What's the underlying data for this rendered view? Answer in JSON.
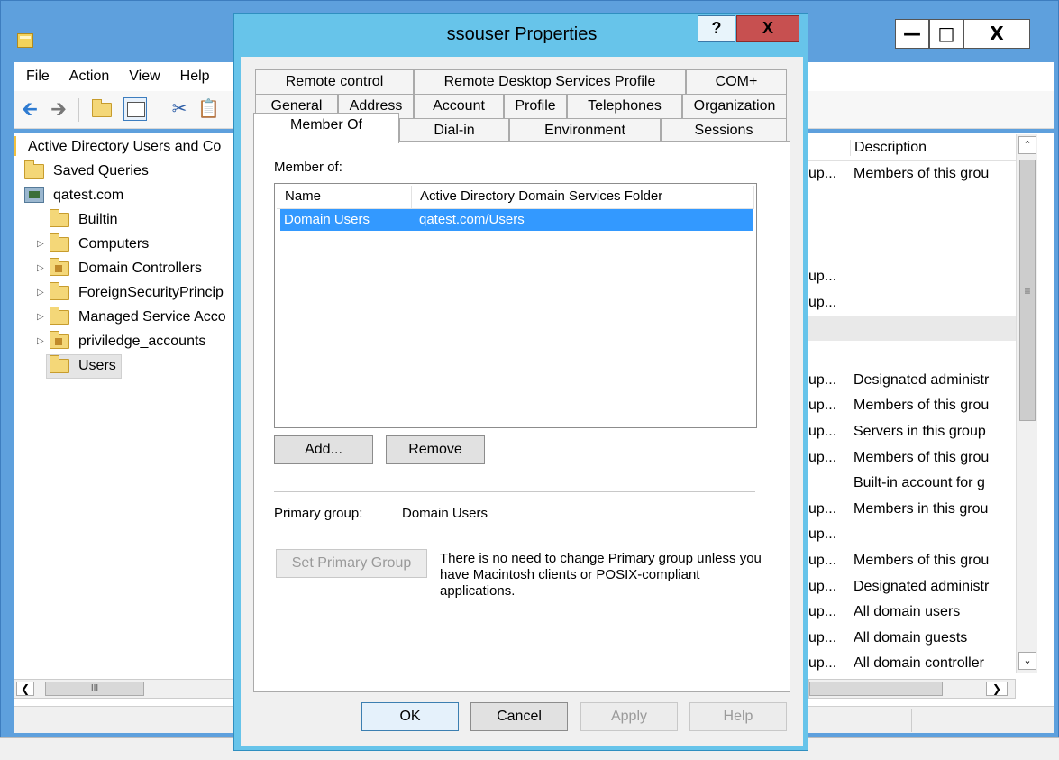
{
  "mmc": {
    "menu": [
      "File",
      "Action",
      "View",
      "Help"
    ],
    "tree": {
      "root": "Active Directory Users and Co",
      "items": [
        {
          "label": "Saved Queries",
          "icon": "folder-icon",
          "expandable": false
        },
        {
          "label": "qatest.com",
          "icon": "domain-icon",
          "expandable": false
        },
        {
          "label": "Builtin",
          "icon": "folder-icon",
          "expandable": false
        },
        {
          "label": "Computers",
          "icon": "folder-icon",
          "expandable": true
        },
        {
          "label": "Domain Controllers",
          "icon": "ou-icon",
          "expandable": true
        },
        {
          "label": "ForeignSecurityPrincip",
          "icon": "folder-icon",
          "expandable": true
        },
        {
          "label": "Managed Service Acco",
          "icon": "folder-icon",
          "expandable": true
        },
        {
          "label": "priviledge_accounts",
          "icon": "ou-icon",
          "expandable": true
        },
        {
          "label": "Users",
          "icon": "folder-icon",
          "expandable": false
        }
      ]
    },
    "list": {
      "column_description": "Description",
      "rows": [
        {
          "type": "up...",
          "desc": "Members of this grou"
        },
        {
          "type": "",
          "desc": ""
        },
        {
          "type": "",
          "desc": ""
        },
        {
          "type": "",
          "desc": ""
        },
        {
          "type": "up...",
          "desc": ""
        },
        {
          "type": "up...",
          "desc": ""
        },
        {
          "type": "",
          "desc": ""
        },
        {
          "type": "",
          "desc": ""
        },
        {
          "type": "up...",
          "desc": "Designated administr"
        },
        {
          "type": "up...",
          "desc": "Members of this grou"
        },
        {
          "type": "up...",
          "desc": "Servers in this group"
        },
        {
          "type": "up...",
          "desc": "Members of this grou"
        },
        {
          "type": "",
          "desc": "Built-in account for g"
        },
        {
          "type": "up...",
          "desc": "Members in this grou"
        },
        {
          "type": "up...",
          "desc": ""
        },
        {
          "type": "up...",
          "desc": "Members of this grou"
        },
        {
          "type": "up...",
          "desc": "Designated administr"
        },
        {
          "type": "up...",
          "desc": "All domain users"
        },
        {
          "type": "up...",
          "desc": "All domain guests"
        },
        {
          "type": "up...",
          "desc": "All domain controller"
        }
      ]
    }
  },
  "dialog": {
    "title": "ssouser Properties",
    "help_button": "?",
    "close_button": "X",
    "tabs_row1": [
      "Remote control",
      "Remote Desktop Services Profile",
      "COM+"
    ],
    "tabs_row2": [
      "General",
      "Address",
      "Account",
      "Profile",
      "Telephones",
      "Organization"
    ],
    "tabs_row3": [
      "Member Of",
      "Dial-in",
      "Environment",
      "Sessions"
    ],
    "active_tab": "Member Of",
    "member_of_label": "Member of:",
    "columns": [
      "Name",
      "Active Directory Domain Services Folder"
    ],
    "groups": [
      {
        "name": "Domain Users",
        "folder": "qatest.com/Users",
        "selected": true
      }
    ],
    "add_button": "Add...",
    "remove_button": "Remove",
    "primary_group_label": "Primary group:",
    "primary_group_value": "Domain Users",
    "set_primary_button": "Set Primary Group",
    "primary_note": "There is no need to change Primary group unless you have Macintosh clients or POSIX-compliant applications.",
    "ok_button": "OK",
    "cancel_button": "Cancel",
    "apply_button": "Apply",
    "help_footer_button": "Help"
  },
  "colors": {
    "selection": "#3399ff",
    "dialog_frame": "#67c4ea",
    "close_button": "#c75050",
    "mmc_frame": "#5ea0dd"
  }
}
